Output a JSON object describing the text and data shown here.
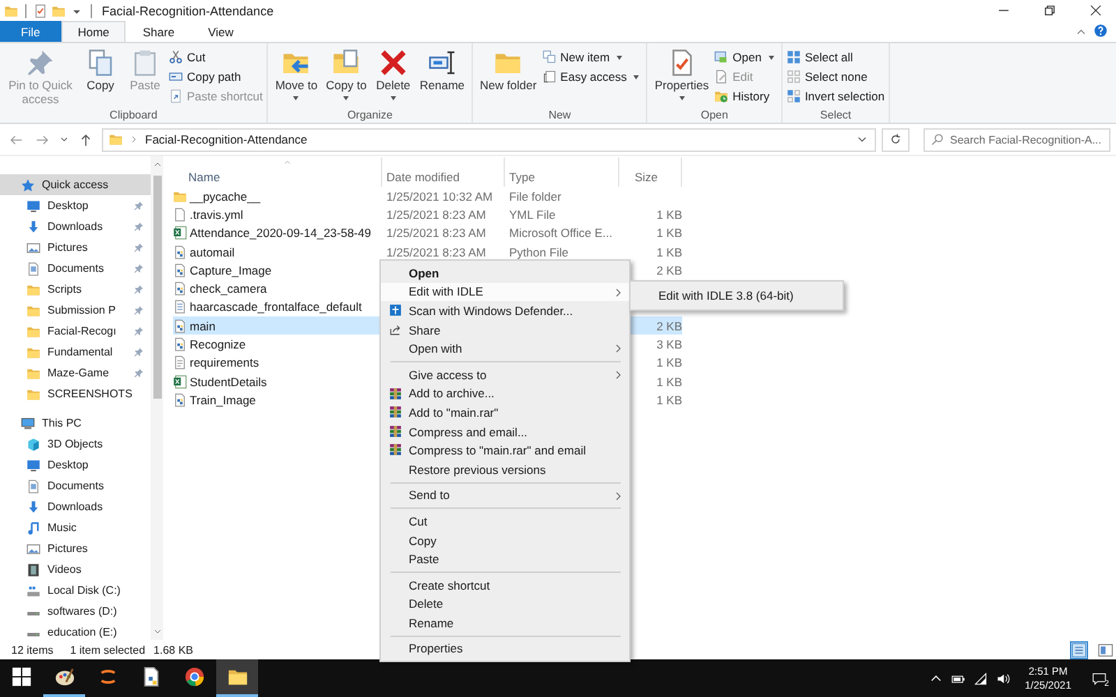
{
  "window": {
    "title": "Facial-Recognition-Attendance"
  },
  "ribbon_tabs": [
    {
      "label": "File",
      "kind": "file",
      "selected": false
    },
    {
      "label": "Home",
      "kind": "tab",
      "selected": true
    },
    {
      "label": "Share",
      "kind": "tab",
      "selected": false
    },
    {
      "label": "View",
      "kind": "tab",
      "selected": false
    }
  ],
  "ribbon_groups": [
    {
      "label": "Clipboard",
      "large": [
        {
          "label": "Pin to Quick access",
          "disabled": true,
          "dropdown": false
        },
        {
          "label": "Copy",
          "disabled": false,
          "dropdown": false
        },
        {
          "label": "Paste",
          "disabled": true,
          "dropdown": false
        }
      ],
      "small": [
        {
          "label": "Cut",
          "disabled": false,
          "dropdown": false
        },
        {
          "label": "Copy path",
          "disabled": false,
          "dropdown": false
        },
        {
          "label": "Paste shortcut",
          "disabled": true,
          "dropdown": false
        }
      ]
    },
    {
      "label": "Organize",
      "large": [
        {
          "label": "Move to",
          "disabled": false,
          "dropdown": true
        },
        {
          "label": "Copy to",
          "disabled": false,
          "dropdown": true
        },
        {
          "label": "Delete",
          "disabled": false,
          "dropdown": true
        },
        {
          "label": "Rename",
          "disabled": false,
          "dropdown": false
        }
      ]
    },
    {
      "label": "New",
      "large": [
        {
          "label": "New folder",
          "disabled": false,
          "dropdown": false
        }
      ],
      "small": [
        {
          "label": "New item",
          "disabled": false,
          "dropdown": true
        },
        {
          "label": "Easy access",
          "disabled": false,
          "dropdown": true
        }
      ]
    },
    {
      "label": "Open",
      "large": [
        {
          "label": "Properties",
          "disabled": false,
          "dropdown": true
        }
      ],
      "small": [
        {
          "label": "Open",
          "disabled": false,
          "dropdown": true
        },
        {
          "label": "Edit",
          "disabled": true,
          "dropdown": false
        },
        {
          "label": "History",
          "disabled": false,
          "dropdown": false
        }
      ]
    },
    {
      "label": "Select",
      "small": [
        {
          "label": "Select all",
          "disabled": false,
          "dropdown": false
        },
        {
          "label": "Select none",
          "disabled": false,
          "dropdown": false
        },
        {
          "label": "Invert selection",
          "disabled": false,
          "dropdown": false
        }
      ]
    }
  ],
  "address_bar": {
    "path": [
      "Facial-Recognition-Attendance"
    ],
    "search_placeholder": "Search Facial-Recognition-A..."
  },
  "navigation": [
    {
      "label": "Quick access",
      "selected": true,
      "pinned": false,
      "children": [
        {
          "label": "Desktop",
          "selected": false,
          "pinned": true
        },
        {
          "label": "Downloads",
          "selected": false,
          "pinned": true
        },
        {
          "label": "Pictures",
          "selected": false,
          "pinned": true
        },
        {
          "label": "Documents",
          "selected": false,
          "pinned": true
        },
        {
          "label": "Scripts",
          "selected": false,
          "pinned": true
        },
        {
          "label": "Submission P",
          "selected": false,
          "pinned": true
        },
        {
          "label": "Facial-Recogı",
          "selected": false,
          "pinned": true
        },
        {
          "label": "Fundamental",
          "selected": false,
          "pinned": true
        },
        {
          "label": "Maze-Game",
          "selected": false,
          "pinned": true
        },
        {
          "label": "SCREENSHOTS",
          "selected": false,
          "pinned": false
        }
      ]
    },
    {
      "label": "This PC",
      "selected": false,
      "pinned": false,
      "children": [
        {
          "label": "3D Objects",
          "selected": false,
          "pinned": false
        },
        {
          "label": "Desktop",
          "selected": false,
          "pinned": false
        },
        {
          "label": "Documents",
          "selected": false,
          "pinned": false
        },
        {
          "label": "Downloads",
          "selected": false,
          "pinned": false
        },
        {
          "label": "Music",
          "selected": false,
          "pinned": false
        },
        {
          "label": "Pictures",
          "selected": false,
          "pinned": false
        },
        {
          "label": "Videos",
          "selected": false,
          "pinned": false
        },
        {
          "label": "Local Disk (C:)",
          "selected": false,
          "pinned": false
        },
        {
          "label": "softwares (D:)",
          "selected": false,
          "pinned": false
        },
        {
          "label": "education (E:)",
          "selected": false,
          "pinned": false
        }
      ]
    }
  ],
  "columns": [
    {
      "label": "Name",
      "sorted": true
    },
    {
      "label": "Date modified",
      "sorted": false
    },
    {
      "label": "Type",
      "sorted": false
    },
    {
      "label": "Size",
      "sorted": false
    }
  ],
  "files": [
    {
      "name": "__pycache__",
      "kind": "folder",
      "date": "1/25/2021 10:32 AM",
      "type": "File folder",
      "selected": false
    },
    {
      "name": ".travis.yml",
      "kind": "file",
      "date": "1/25/2021 8:23 AM",
      "type": "YML File",
      "size": "1 KB",
      "selected": false
    },
    {
      "name": "Attendance_2020-09-14_23-58-49",
      "kind": "spreadsheet",
      "date": "1/25/2021 8:23 AM",
      "type": "Microsoft Office E...",
      "size": "1 KB",
      "selected": false
    },
    {
      "name": "automail",
      "kind": "script",
      "date": "1/25/2021 8:23 AM",
      "type": "Python File",
      "size": "1 KB",
      "selected": false
    },
    {
      "name": "Capture_Image",
      "kind": "script",
      "size": "2 KB",
      "selected": false
    },
    {
      "name": "check_camera",
      "kind": "script",
      "selected": false
    },
    {
      "name": "haarcascade_frontalface_default",
      "kind": "data",
      "selected": false
    },
    {
      "name": "main",
      "kind": "script",
      "size": "2 KB",
      "selected": true
    },
    {
      "name": "Recognize",
      "kind": "script",
      "size": "3 KB",
      "selected": false
    },
    {
      "name": "requirements",
      "kind": "text",
      "size": "1 KB",
      "selected": false
    },
    {
      "name": "StudentDetails",
      "kind": "spreadsheet",
      "size": "1 KB",
      "selected": false
    },
    {
      "name": "Train_Image",
      "kind": "script",
      "size": "1 KB",
      "selected": false
    }
  ],
  "context_menu": {
    "items": [
      {
        "label": "Open",
        "default": true,
        "selected": false,
        "submenu": false,
        "separator_after": false
      },
      {
        "label": "Edit with IDLE",
        "default": false,
        "selected": true,
        "submenu": true,
        "separator_after": false
      },
      {
        "label": "Scan with Windows Defender...",
        "default": false,
        "selected": false,
        "submenu": false,
        "separator_after": false
      },
      {
        "label": "Share",
        "default": false,
        "selected": false,
        "submenu": false,
        "separator_after": false
      },
      {
        "label": "Open with",
        "default": false,
        "selected": false,
        "submenu": true,
        "separator_after": true
      },
      {
        "label": "Give access to",
        "default": false,
        "selected": false,
        "submenu": true,
        "separator_after": false
      },
      {
        "label": "Add to archive...",
        "default": false,
        "selected": false,
        "submenu": false,
        "separator_after": false
      },
      {
        "label": "Add to \"main.rar\"",
        "default": false,
        "selected": false,
        "submenu": false,
        "separator_after": false
      },
      {
        "label": "Compress and email...",
        "default": false,
        "selected": false,
        "submenu": false,
        "separator_after": false
      },
      {
        "label": "Compress to \"main.rar\" and email",
        "default": false,
        "selected": false,
        "submenu": false,
        "separator_after": false
      },
      {
        "label": "Restore previous versions",
        "default": false,
        "selected": false,
        "submenu": false,
        "separator_after": true
      },
      {
        "label": "Send to",
        "default": false,
        "selected": false,
        "submenu": true,
        "separator_after": true
      },
      {
        "label": "Cut",
        "default": false,
        "selected": false,
        "submenu": false,
        "separator_after": false
      },
      {
        "label": "Copy",
        "default": false,
        "selected": false,
        "submenu": false,
        "separator_after": false
      },
      {
        "label": "Paste",
        "default": false,
        "selected": false,
        "submenu": false,
        "separator_after": true
      },
      {
        "label": "Create shortcut",
        "default": false,
        "selected": false,
        "submenu": false,
        "separator_after": false
      },
      {
        "label": "Delete",
        "default": false,
        "selected": false,
        "submenu": false,
        "separator_after": false
      },
      {
        "label": "Rename",
        "default": false,
        "selected": false,
        "submenu": false,
        "separator_after": true
      },
      {
        "label": "Properties",
        "default": false,
        "selected": false,
        "submenu": false,
        "separator_after": false
      }
    ],
    "submenu": [
      {
        "label": "Edit with IDLE 3.8 (64-bit)",
        "selected": false
      }
    ]
  },
  "status_bar": {
    "item_count": "12 items",
    "selection": "1 item selected",
    "selection_size": "1.68 KB",
    "views": [
      {
        "selected": true
      },
      {
        "selected": false
      }
    ]
  },
  "taskbar": {
    "apps": [
      {
        "running": false,
        "focused": false
      },
      {
        "running": true,
        "focused": false
      },
      {
        "running": false,
        "focused": false
      },
      {
        "running": false,
        "focused": false
      },
      {
        "running": false,
        "focused": false
      },
      {
        "running": true,
        "focused": true
      }
    ],
    "time": "2:51 PM",
    "date": "1/25/2021",
    "notifications": "2"
  }
}
